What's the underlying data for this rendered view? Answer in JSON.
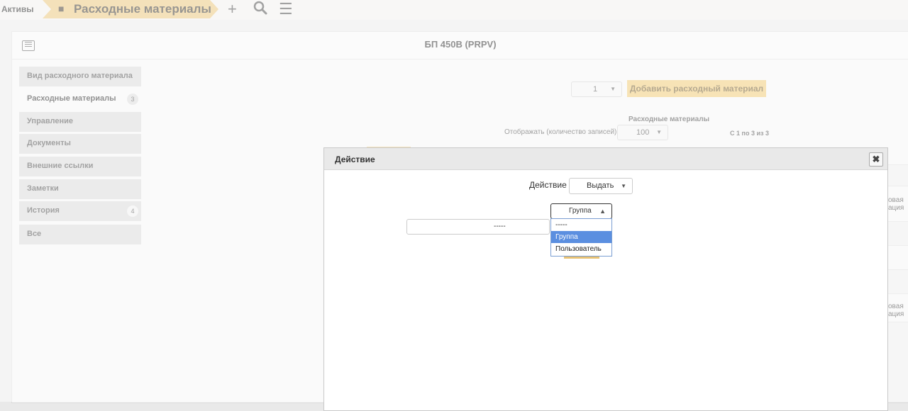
{
  "breadcrumb": {
    "root_label": "Активы",
    "current_label": "Расходные материалы",
    "current_icon": "boxes-icon"
  },
  "toolbar": {
    "add_icon": "+",
    "search_icon": "🔍",
    "menu_icon": "☰"
  },
  "panel": {
    "title": "БП 450В (PRPV)"
  },
  "sidebar": {
    "items": [
      {
        "label": "Вид расходного материала"
      },
      {
        "label": "Расходные материалы",
        "badge": "3"
      },
      {
        "label": "Управление"
      },
      {
        "label": "Документы"
      },
      {
        "label": "Внешние ссылки"
      },
      {
        "label": "Заметки"
      },
      {
        "label": "История",
        "badge": "4"
      },
      {
        "label": "Все"
      }
    ]
  },
  "content": {
    "quantity_value": "1",
    "add_button_label": "Добавить расходный материал",
    "table_caption": "Расходные материалы",
    "show_label": "Отображать (количество записей)",
    "page_size_value": "100",
    "range_text": "С 1 по 3 из 3",
    "right_snippets": [
      [
        "овая",
        "ация"
      ],
      [
        "овая",
        "ация"
      ]
    ]
  },
  "dialog": {
    "title": "Действие",
    "close_label": "✖",
    "action_label": "Действие",
    "action_value": "Выдать",
    "type_value": "Группа",
    "target_value": "-----",
    "options": [
      "-----",
      "Группа",
      "Пользователь"
    ],
    "selected_option_index": 1
  },
  "colors": {
    "accent": "#e8c274",
    "button": "#eec66d",
    "selected_option": "#5b8fe0"
  }
}
